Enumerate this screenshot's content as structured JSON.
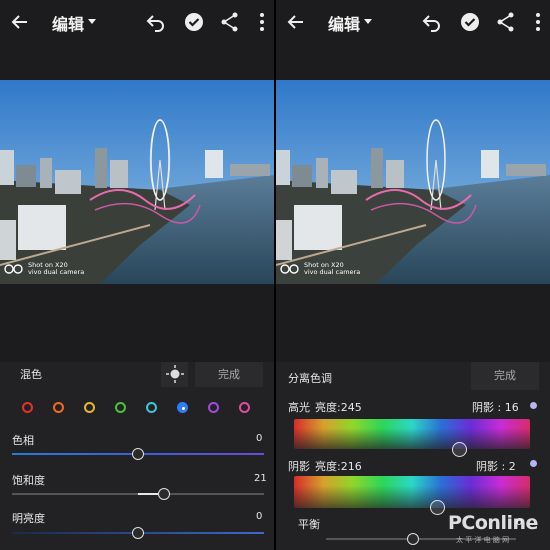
{
  "header": {
    "title": "编辑"
  },
  "photo_watermark": {
    "line1": "Shot on X20",
    "line2": "vivo dual camera"
  },
  "hsl_panel": {
    "title": "混色",
    "done_label": "完成",
    "color_swatches": [
      "#e0322b",
      "#f06a21",
      "#e6b62a",
      "#4fbf3c",
      "#3bc6d4",
      "#2f7df6",
      "#a04be0",
      "#e04aa0"
    ],
    "selected_swatch_index": 5,
    "sliders": [
      {
        "label": "色相",
        "value": "0"
      },
      {
        "label": "饱和度",
        "value": "21"
      },
      {
        "label": "明亮度",
        "value": "0"
      }
    ]
  },
  "split_toning": {
    "title": "分离色调",
    "done_label": "完成",
    "highlights": {
      "label": "高光",
      "brightness_label": "亮度:245",
      "shadow_label": "阴影 : 16"
    },
    "shadows": {
      "label": "阴影",
      "brightness_label": "亮度:216",
      "shadow_label": "阴影 : 2"
    },
    "balance": {
      "label": "平衡",
      "value": "0"
    }
  },
  "watermark": {
    "brand": "PConline",
    "sub": "太 平 洋 电 脑 网"
  }
}
